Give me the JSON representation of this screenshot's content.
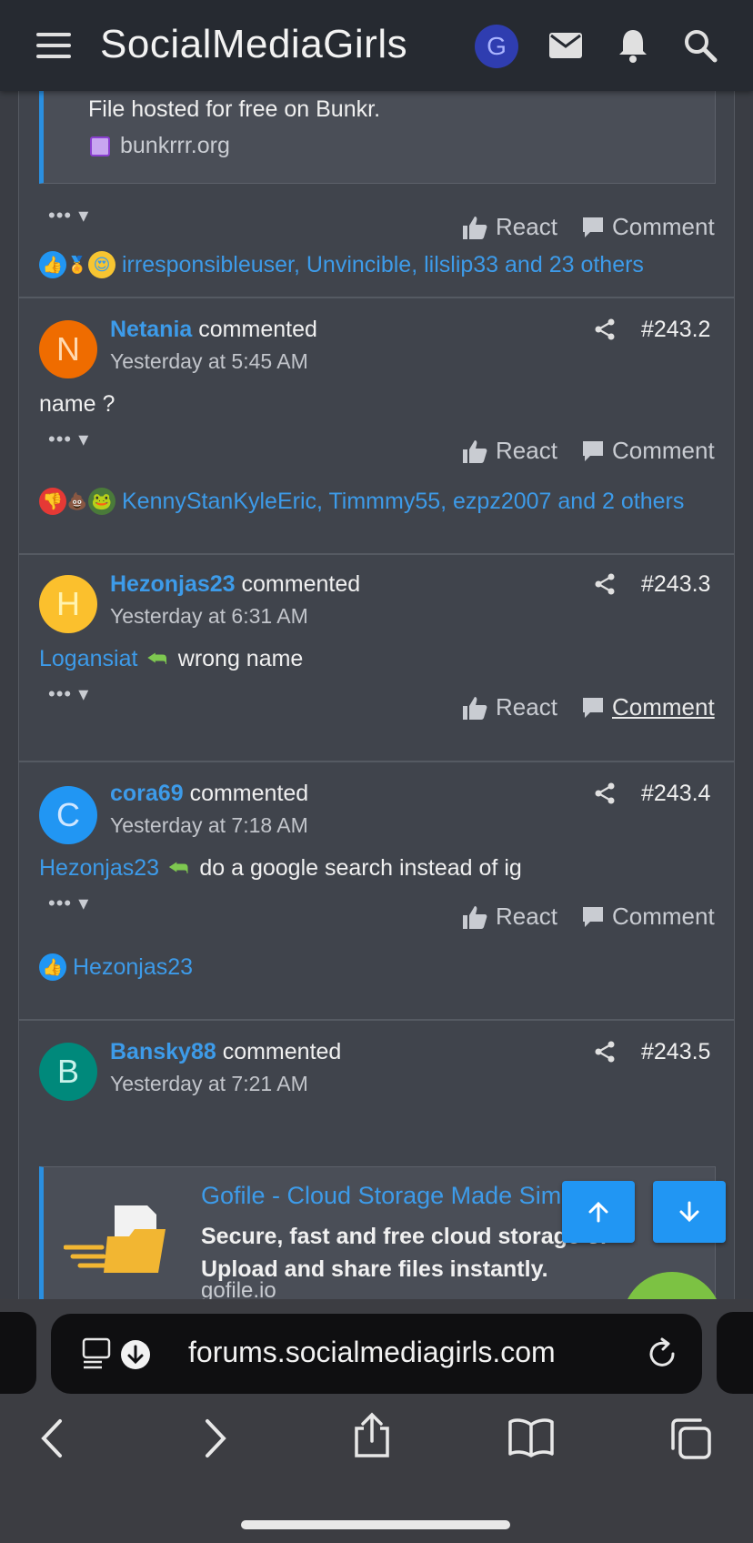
{
  "header": {
    "site_title": "SocialMediaGirls",
    "user_initial": "G"
  },
  "top_embed": {
    "description": "File hosted for free on Bunkr.",
    "host": "bunkrrr.org"
  },
  "post_actions": {
    "dots": "••• ▾",
    "react_label": "React",
    "comment_label": "Comment"
  },
  "top_reactions": {
    "text": "irresponsibleuser, Unvincible, lilslip33 and 23 others"
  },
  "comments": [
    {
      "initial": "N",
      "avatar_color": "#ef6c00",
      "avatar_text_color": "#ffd9b0",
      "username": "Netania",
      "verb": "commented",
      "time": "Yesterday at 5:45 AM",
      "number": "#243.2",
      "body": "name ?",
      "reactions": "KennyStanKyleEric, Timmmy55, ezpz2007 and 2 others"
    },
    {
      "initial": "H",
      "avatar_color": "#fbc02d",
      "avatar_text_color": "#fff3b0",
      "username": "Hezonjas23",
      "verb": "commented",
      "time": "Yesterday at 6:31 AM",
      "number": "#243.3",
      "mention": "Logansiat",
      "body": "wrong name"
    },
    {
      "initial": "C",
      "avatar_color": "#2196f3",
      "avatar_text_color": "#cfe6ff",
      "username": "cora69",
      "verb": "commented",
      "time": "Yesterday at 7:18 AM",
      "number": "#243.4",
      "mention": "Hezonjas23",
      "body": "do a google search instead of ig",
      "reactions": "Hezonjas23"
    },
    {
      "initial": "B",
      "avatar_color": "#00897b",
      "avatar_text_color": "#c8f2ea",
      "username": "Bansky88",
      "verb": "commented",
      "time": "Yesterday at 7:21 AM",
      "number": "#243.5"
    }
  ],
  "gofile_embed": {
    "title": "Gofile - Cloud Storage Made Sim",
    "description_line1": "Secure, fast and free cloud storage",
    "description_line1_tail": "or",
    "description_line2": "Upload and share files instantly.",
    "url": "gofile.io"
  },
  "browser": {
    "url": "forums.socialmediagirls.com"
  },
  "colors": {
    "accent": "#3d9be9",
    "header_bg": "#262a31",
    "content_bg": "#40444c",
    "scroll_button": "#2196f3"
  }
}
